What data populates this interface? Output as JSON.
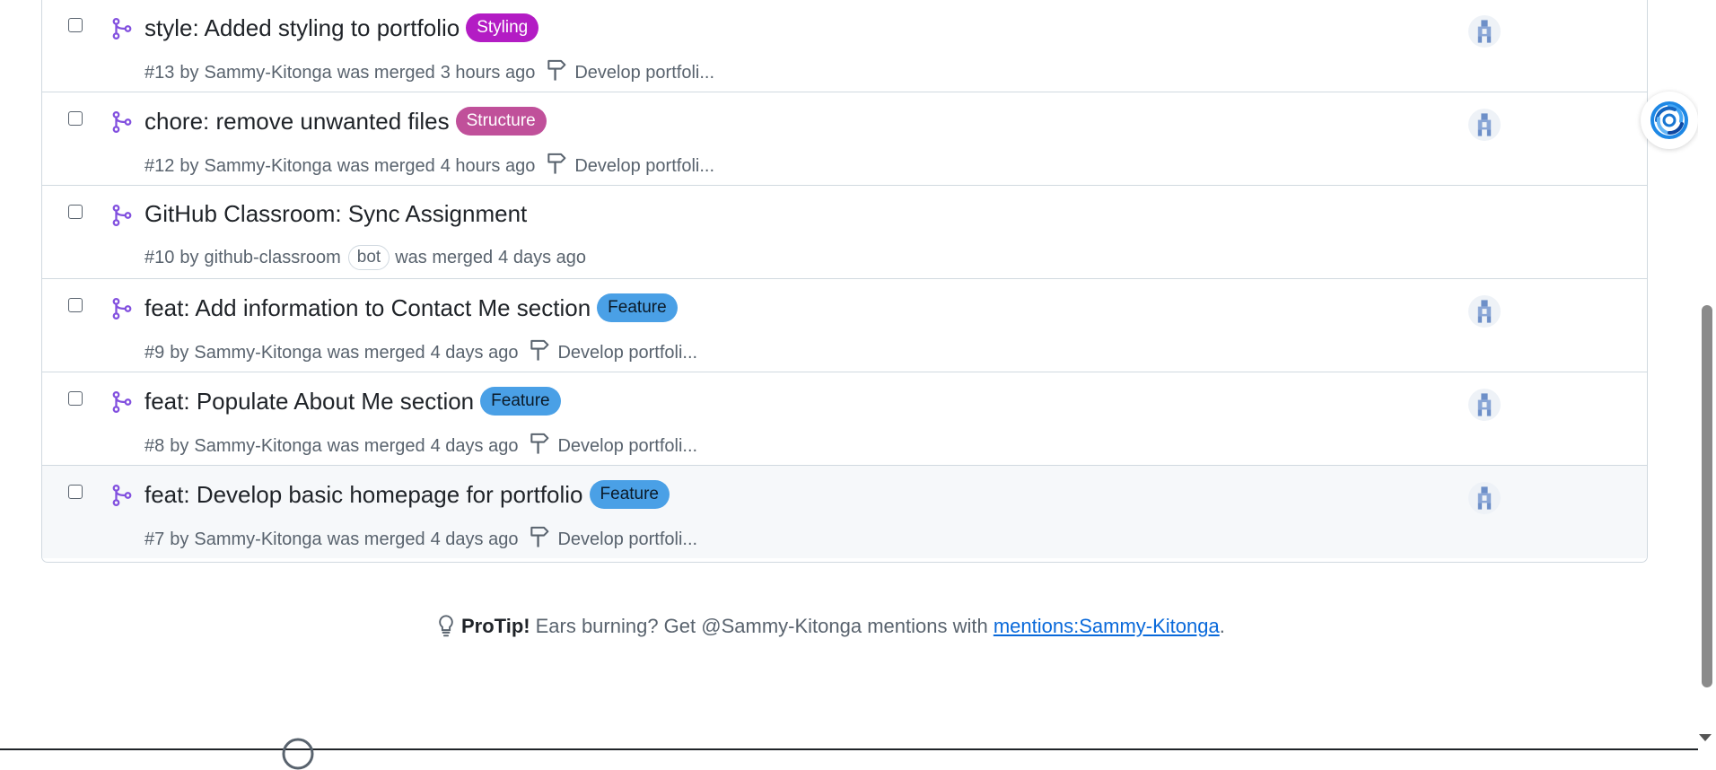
{
  "pull_requests": [
    {
      "title": "style: Added styling to portfolio",
      "label": {
        "text": "Styling",
        "bg": "#b31cc4",
        "fg": "#ffffff"
      },
      "number": "#13",
      "by_text": "by",
      "author": "Sammy-Kitonga",
      "author_badge": "",
      "status": "was merged",
      "when": "3 hours ago",
      "milestone": "Develop portfoli...",
      "has_avatar": true
    },
    {
      "title": "chore: remove unwanted files",
      "label": {
        "text": "Structure",
        "bg": "#c0509a",
        "fg": "#ffffff"
      },
      "number": "#12",
      "by_text": "by",
      "author": "Sammy-Kitonga",
      "author_badge": "",
      "status": "was merged",
      "when": "4 hours ago",
      "milestone": "Develop portfoli...",
      "has_avatar": true
    },
    {
      "title": "GitHub Classroom: Sync Assignment",
      "label": null,
      "number": "#10",
      "by_text": "by",
      "author": "github-classroom",
      "author_badge": "bot",
      "status": "was merged",
      "when": "4 days ago",
      "milestone": "",
      "has_avatar": false
    },
    {
      "title": "feat: Add information to Contact Me section",
      "label": {
        "text": "Feature",
        "bg": "#4aa0e6",
        "fg": "#0b1a28"
      },
      "number": "#9",
      "by_text": "by",
      "author": "Sammy-Kitonga",
      "author_badge": "",
      "status": "was merged",
      "when": "4 days ago",
      "milestone": "Develop portfoli...",
      "has_avatar": true
    },
    {
      "title": "feat: Populate About Me section",
      "label": {
        "text": "Feature",
        "bg": "#4aa0e6",
        "fg": "#0b1a28"
      },
      "number": "#8",
      "by_text": "by",
      "author": "Sammy-Kitonga",
      "author_badge": "",
      "status": "was merged",
      "when": "4 days ago",
      "milestone": "Develop portfoli...",
      "has_avatar": true
    },
    {
      "title": "feat: Develop basic homepage for portfolio",
      "label": {
        "text": "Feature",
        "bg": "#4aa0e6",
        "fg": "#0b1a28"
      },
      "number": "#7",
      "by_text": "by",
      "author": "Sammy-Kitonga",
      "author_badge": "",
      "status": "was merged",
      "when": "4 days ago",
      "milestone": "Develop portfoli...",
      "has_avatar": true,
      "highlighted": true
    }
  ],
  "protip": {
    "bold": "ProTip!",
    "text": "Ears burning? Get @Sammy-Kitonga mentions with",
    "link": "mentions:Sammy-Kitonga",
    "end": "."
  },
  "colors": {
    "merged_purple": "#8250df",
    "link_blue": "#0969da",
    "muted": "#59636e",
    "border": "#d1d9e0"
  },
  "icons": {
    "merged": "git-merge-icon",
    "milestone": "milestone-icon",
    "protip": "light-bulb-icon",
    "avatar": "identicon-avatar-icon",
    "extension": "ai-assistant-icon"
  }
}
